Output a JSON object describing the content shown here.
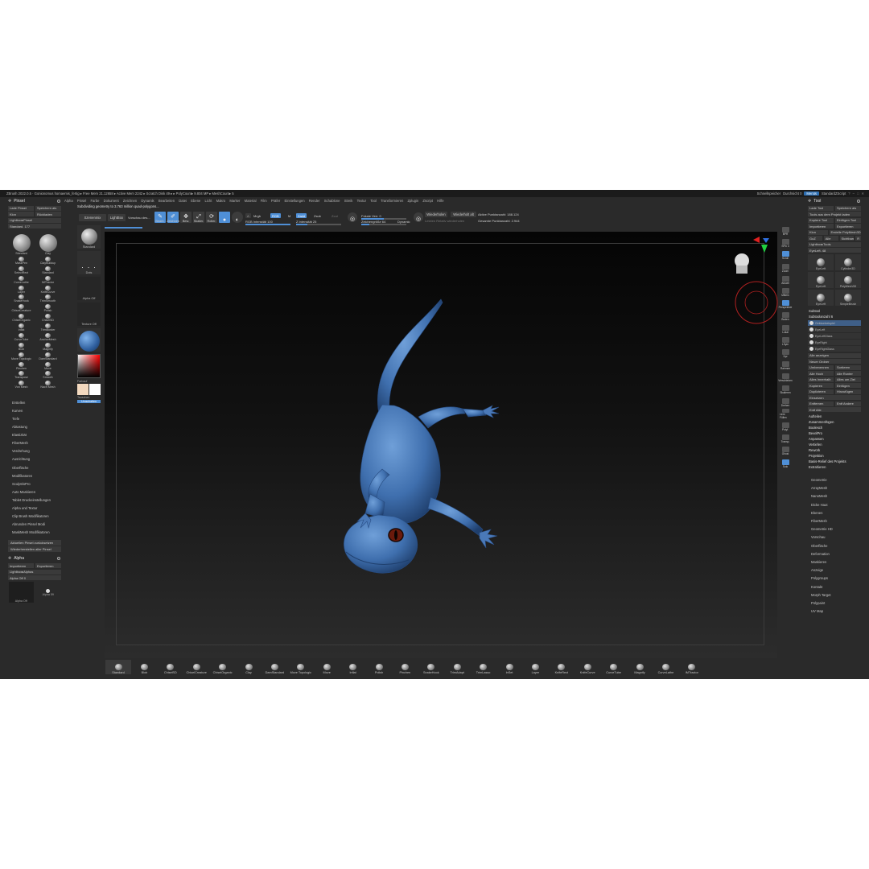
{
  "titlebar": {
    "title": "ZBrush 2022.0.5 · Gonionomus homaemis_fertig  ▸ Free Mem 21.12658 ▸ Active Mem 2242 ▸ Scratch Disk 49 ▸ ▸ PolyCount▸ 9.804 MP ▸ MeshCount▸ 5",
    "quicksave": "Schnellspeicher",
    "seethrough": "Durchsicht 0",
    "menus_btn": "Menüs",
    "script": "StandardZScript"
  },
  "menubar": [
    "Alpha",
    "Pinsel",
    "Farbe",
    "Dokument",
    "Zeichnen",
    "Dynamik",
    "Bearbeiten",
    "Datei",
    "Ebene",
    "Licht",
    "Makro",
    "Marker",
    "Material",
    "Film",
    "Präfer",
    "Einstellungen",
    "Render",
    "Schablone",
    "Streik",
    "Textur",
    "Tool",
    "Transformieren",
    "Zplugin",
    "Zscript",
    "Hilfe"
  ],
  "status": "Subdividing geometry to 3.763 million quad-polygons...",
  "toolbar": {
    "scenemix": "Szenenmix",
    "lightbox": "LightBox",
    "preview": "Vorschau des...",
    "edit": "Bearb.",
    "draw": "Zeichnen",
    "move": "Bew.",
    "scale": "Skalier.",
    "rotate": "Rotier.",
    "mrgb": "Mrgb",
    "rgb": "RGB",
    "m": "M",
    "zadd": "Zadd",
    "zsub": "Zsub",
    "zcut": "Zcut",
    "rgb_intensity": "RGB Intensität 100",
    "z_intensity": "Z Intensität 25",
    "focal": "Fokale Verr. 0",
    "draw_size": "Zeichengröße 64",
    "dynamic": "Dynamic",
    "replay": "Wiederholen",
    "replay_last": "Wiederholt alt",
    "active_points": "Aktive Punktanzahl: 188.124",
    "total_points": "Gesamte Punktanzahl: 2.944",
    "replay_rel": "Letzten Relativ wiederholen"
  },
  "left_panel": {
    "title": "Pinsel",
    "load": "Lade Pinsel",
    "save_as": "Speichern als",
    "clone": "Klon",
    "undo": "Rückladen",
    "lightbox": "Lightbox▸Pinsel",
    "standard": "Standard. 177",
    "brushes": [
      "Standard",
      "Clay",
      "MaskPen",
      "ClayBuildup",
      "SelectRect",
      "Standard",
      "CurveLathe",
      "IMTractor",
      "Layer",
      "KnifeCurve",
      "SnakeHook",
      "TrimSmooth",
      "ChiselCreature",
      "Polish",
      "ChiselOrganic",
      "ChiselSD",
      "Inflat",
      "TrimBorder",
      "CurveTube",
      "AnchorMesh",
      "Blob",
      "Magnify",
      "Move Topologic",
      "DamStandard",
      "Pinchen",
      "Move",
      "Transpose",
      "Smooth",
      "Von Mesh",
      "Nach Mesh"
    ],
    "menu": [
      "Erstellen",
      "Kurven",
      "Tiefe",
      "Abtastung",
      "Elastizität",
      "FiberMesh",
      "Verdrehung",
      "Ausrichtung",
      "Oberfläche",
      "Modifikatoren",
      "SculptrisPro",
      "Auto Maskieren",
      "Tablet Druckeinstellungen",
      "Alpha und Textur",
      "Clip Brush Modifikatoren",
      "Abrunden Pinsel Modi",
      "MaskMesh Modifikatoren"
    ],
    "reset_current": "Aktuellen Pinsel zurücksetzen",
    "reset_all": "Wiederherstellen aller Pinsel",
    "alpha_title": "Alpha",
    "alpha_import": "Importieren",
    "alpha_export": "Exportieren",
    "alpha_lightbox": "Lightbox▸Alphas",
    "alpha_off": "Alpha Off  0",
    "alpha_items": [
      "Alpha Off",
      "Alpha 28",
      "Alpha 59"
    ]
  },
  "second_col": [
    "Standard",
    "Dots",
    "Alpha Off",
    "Texture Off",
    "Farbauf",
    "Tauschen",
    "Umschalten"
  ],
  "right_shelf": [
    "BPR",
    "SPix 3",
    "Scroll",
    "Zoom",
    "Aktuell",
    "Mitteln",
    "Perspektive",
    "Boden",
    "Lokal",
    "LSym",
    "Xyz",
    "Rahmen",
    "Verschieben",
    "Skalieren",
    "Drehen",
    "Linie Füllen",
    "Polyf.",
    "Transp.",
    "Ghost",
    "Solo"
  ],
  "right_panel": {
    "title": "Tool",
    "load": "Lade Tool",
    "save_as": "Speichern als",
    "load_project": "Tools aus dem Projekt laden",
    "copy_tool": "Kopiere Tool",
    "insert_tool": "Einfügen Tool",
    "import": "Importieren",
    "export": "Exportieren",
    "clone": "Klon",
    "polymesh": "Erstelle PolyMesh3D",
    "goz": "GoZ",
    "all": "Alle",
    "visible": "Sichtbare",
    "r": "R",
    "lightbox": "Lightbox▸Tools",
    "eyeleft": "EyeLeft. 48",
    "tools": [
      "EyeLeft",
      "Cylinder3D",
      "EyeLeft",
      "PolyMesh3D",
      "EyeLeft",
      "SimpleBrush"
    ],
    "subtool": "Subtool",
    "subtool_count": "Subtoolanzahl 6",
    "subtools": [
      "Gekkonbeispiel",
      "EyeLeft",
      "EyeLeftGlass",
      "EyeRight",
      "EyeRightGlass"
    ],
    "show_all": "Alle anzeigen",
    "new_folder": "Neuer Ordner",
    "ops": [
      "Umbenennen",
      "Sortieren",
      "Alle Hoch",
      "Alle Runter",
      "Alles Innerhalb",
      "Alles um Ziel"
    ],
    "copy": "Kopieren",
    "paste": "Einfügen",
    "duplicate": "Duplizieren",
    "append": "Hinzufügen",
    "insert": "Einsetzen",
    "delete": "Entfernen",
    "del_other": "Entf Andere",
    "del_all": "Entf Alle",
    "split": "Aufteilen",
    "merge": "Zusammenfügen",
    "extra": [
      "Boolesch",
      "BevelPro",
      "Anpassen",
      "Vertiefen",
      "Rework",
      "Projektion",
      "Basis-Relief des Projekts",
      "Extrahieren"
    ],
    "menu": [
      "Geometrie",
      "ArrayMesh",
      "NanoMesh",
      "Dicke Haut",
      "Ebenen",
      "FiberMesh",
      "Geometrie HD",
      "Vorschau",
      "Oberfläche",
      "Deformation",
      "Maskieren",
      "Anzeige",
      "Polygroups",
      "Kontakt",
      "Morph Target",
      "Polypaint",
      "UV Map"
    ]
  },
  "bottom_shelf": [
    "Standard",
    "Blob",
    "ChiselSD",
    "ChiselCreature",
    "ChiselOrganic",
    "Clay",
    "DamStandard",
    "Move Topologic",
    "Move",
    "Inflat",
    "Polish",
    "Pinchen",
    "SnakeHook",
    "TrimAdapt",
    "TrimLasso",
    "InSet",
    "Layer",
    "KnifeRect",
    "KnifeCurve",
    "CurveTube",
    "Magnify",
    "CurveLathe",
    "IMTractor"
  ]
}
